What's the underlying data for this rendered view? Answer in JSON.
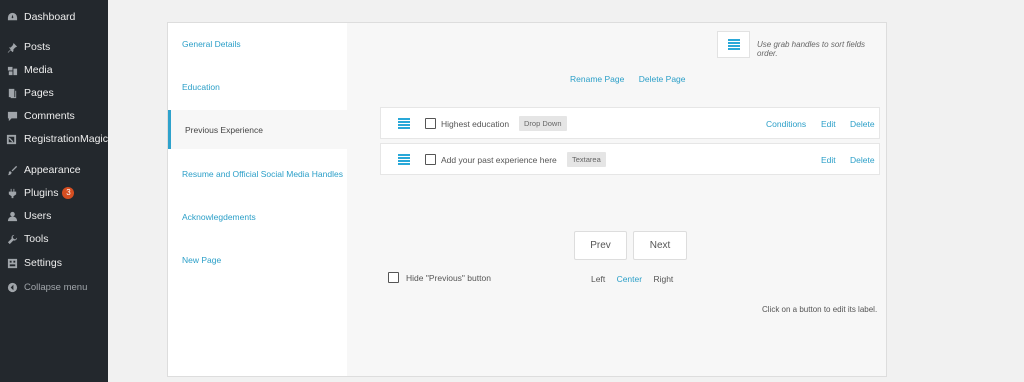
{
  "admin_menu": {
    "items": [
      {
        "label": "Dashboard",
        "icon": "dashboard-icon"
      },
      {
        "label": "Posts",
        "icon": "pin-icon"
      },
      {
        "label": "Media",
        "icon": "media-icon"
      },
      {
        "label": "Pages",
        "icon": "pages-icon"
      },
      {
        "label": "Comments",
        "icon": "comment-icon"
      },
      {
        "label": "RegistrationMagic",
        "icon": "registrationmagic-icon"
      },
      {
        "label": "Appearance",
        "icon": "brush-icon"
      },
      {
        "label": "Plugins",
        "icon": "plugin-icon",
        "badge": "3"
      },
      {
        "label": "Users",
        "icon": "user-icon"
      },
      {
        "label": "Tools",
        "icon": "wrench-icon"
      },
      {
        "label": "Settings",
        "icon": "settings-icon"
      }
    ],
    "collapse_label": "Collapse menu"
  },
  "pages": [
    {
      "label": "General Details"
    },
    {
      "label": "Education"
    },
    {
      "label": "Previous Experience",
      "active": true
    },
    {
      "label": "Resume and Official Social Media Handles"
    },
    {
      "label": "Acknowlegdements"
    },
    {
      "label": "New Page"
    }
  ],
  "sort_hint": "Use grab handles to sort fields order.",
  "page_actions": {
    "rename": "Rename Page",
    "delete": "Delete Page"
  },
  "fields": [
    {
      "label": "Highest education",
      "type": "Drop Down",
      "conditions": "Conditions",
      "edit": "Edit",
      "delete": "Delete"
    },
    {
      "label": "Add your past experience here",
      "type": "Textarea",
      "edit": "Edit",
      "delete": "Delete"
    }
  ],
  "nav_buttons": {
    "prev": "Prev",
    "next": "Next"
  },
  "hide_previous_label": "Hide \"Previous\" button",
  "alignment": {
    "left": "Left",
    "center": "Center",
    "right": "Right",
    "selected": "Center"
  },
  "edit_hint": "Click on a button to edit its label.",
  "colors": {
    "sidebar_bg": "#23282d",
    "link": "#2b9fc8",
    "active_border": "#2ea2cc",
    "badge": "#d54e21"
  }
}
